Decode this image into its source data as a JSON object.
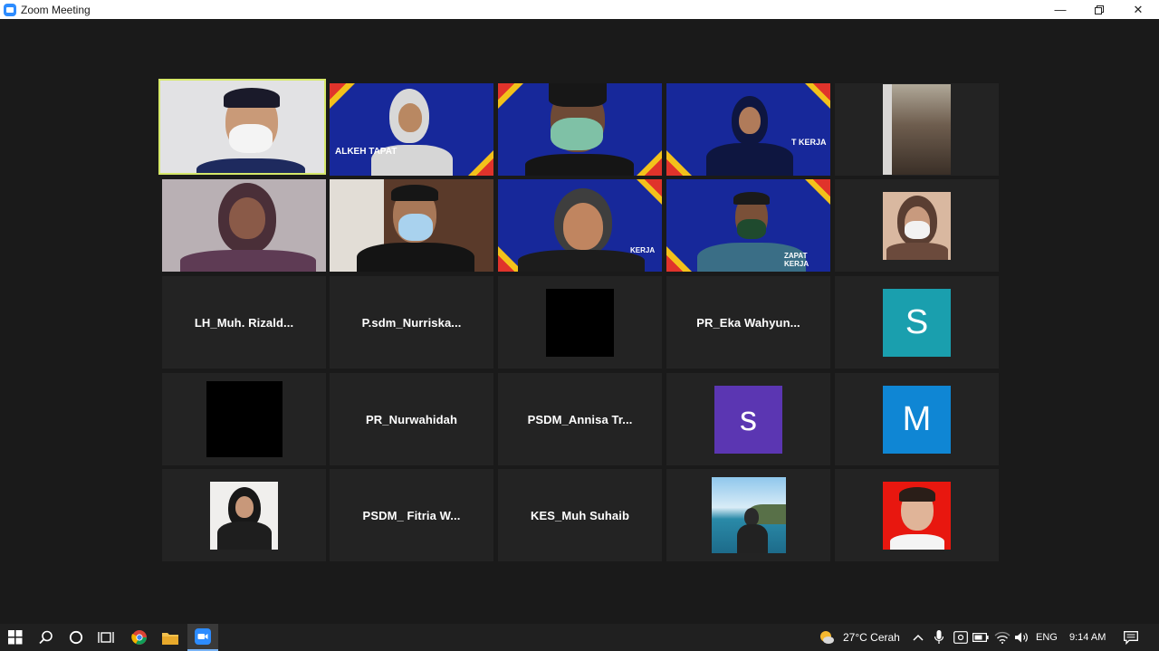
{
  "window": {
    "title": "Zoom Meeting"
  },
  "tiles": {
    "t11": {
      "name": ""
    },
    "t13": {
      "name": "LH_Muh.  Rizald..."
    },
    "t14": {
      "name": "P.sdm_Nurriska..."
    },
    "t15": {
      "name": "PR_Eka  Wahyun..."
    },
    "t16": {
      "letter": "S",
      "color": "#1a9fae"
    },
    "t18": {
      "name": "PR_Nurwahidah"
    },
    "t19": {
      "name": "PSDM_Annisa  Tr..."
    },
    "t20": {
      "letter": "s",
      "color": "#5b36b2"
    },
    "t21": {
      "letter": "M",
      "color": "#0f86d4"
    },
    "t23": {
      "name": "PSDM_  Fitria  W..."
    },
    "t24": {
      "name": "KES_Muh Suhaib"
    }
  },
  "taskbar": {
    "weather": "27°C  Cerah",
    "language": "ENG",
    "clock": "9:14 AM"
  },
  "colors": {
    "stage": "#1a1a1a",
    "tile": "#232323",
    "active_speaker": "#d6e86a",
    "banner": "#17289a"
  }
}
